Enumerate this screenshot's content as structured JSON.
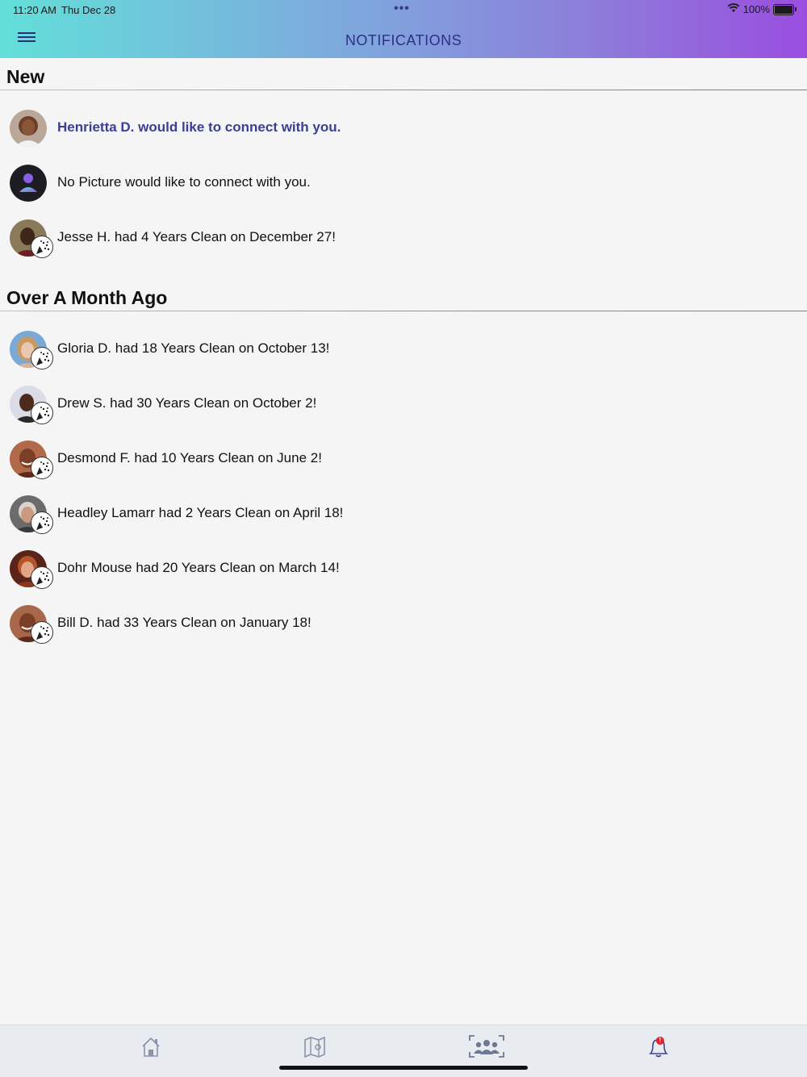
{
  "status_bar": {
    "time": "11:20 AM",
    "date": "Thu Dec 28",
    "dots": "•••",
    "battery": "100%"
  },
  "header": {
    "title": "NOTIFICATIONS",
    "menu_icon": "hamburger-menu-icon"
  },
  "sections": {
    "new": {
      "title": "New",
      "items": [
        {
          "text": "Henrietta D. would like to connect with you.",
          "highlight": true,
          "badge": false,
          "avatar": "photo-woman"
        },
        {
          "text": "No Picture would like to connect with you.",
          "highlight": false,
          "badge": false,
          "avatar": "placeholder-person"
        },
        {
          "text": "Jesse H. had 4 Years Clean on December 27!",
          "highlight": false,
          "badge": true,
          "avatar": "photo-man"
        }
      ]
    },
    "older": {
      "title": "Over A Month Ago",
      "items": [
        {
          "text": "Gloria D. had 18 Years Clean on October 13!",
          "badge": true,
          "avatar": "photo-woman-blonde"
        },
        {
          "text": "Drew S. had 30 Years Clean on October 2!",
          "badge": true,
          "avatar": "photo-man"
        },
        {
          "text": "Desmond F. had 10 Years Clean on June 2!",
          "badge": true,
          "avatar": "photo-man-smiling"
        },
        {
          "text": "Headley Lamarr had 2 Years Clean on April 18!",
          "badge": true,
          "avatar": "photo-man-grey"
        },
        {
          "text": "Dohr Mouse had 20 Years Clean on March 14!",
          "badge": true,
          "avatar": "photo-man-redhead"
        },
        {
          "text": "Bill D. had 33 Years Clean on January 18!",
          "badge": true,
          "avatar": "photo-man-smiling"
        }
      ]
    }
  },
  "tabbar": {
    "tabs": [
      {
        "name": "home",
        "icon": "home-icon"
      },
      {
        "name": "map",
        "icon": "map-icon"
      },
      {
        "name": "groups",
        "icon": "group-icon"
      },
      {
        "name": "notifications",
        "icon": "bell-icon",
        "badge": "!"
      }
    ]
  },
  "colors": {
    "header_gradient_start": "#62dfd9",
    "header_gradient_end": "#9a4ee0",
    "title_color": "#2e2f86",
    "highlight_text": "#3b3f93",
    "notification_badge": "#e0242a"
  }
}
